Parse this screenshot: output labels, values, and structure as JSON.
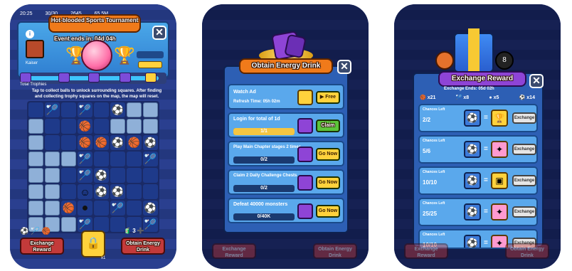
{
  "screen1": {
    "status_time": "20:25",
    "status_coins": "30/30",
    "status_gems": "2645",
    "status_energy": "65 5M",
    "title": "Hot-blooded Sports Tournament",
    "event_ends": "Event ends in: 04d 04h",
    "player_name": "Kaiser",
    "trophy_label": "Total Trophies",
    "milestones": [
      "1",
      "2",
      "3",
      "5",
      "10"
    ],
    "tip": "Tap to collect balls to unlock surrounding squares. After finding and collecting trophy squares on the map, the map will reset.",
    "collected_counts": [
      "12",
      "5",
      "4",
      "1"
    ],
    "exchange_reward_label": "Exchange Reward",
    "center_count": "x1",
    "drink_count": "3",
    "obtain_drink_label": "Obtain Energy Drink",
    "grid": [
      [
        "open",
        "shuttle",
        "open",
        "shuttle",
        "open",
        "soccer",
        "locked",
        "locked"
      ],
      [
        "locked",
        "open",
        "open",
        "basket",
        "open",
        "locked",
        "locked",
        "locked"
      ],
      [
        "locked",
        "open",
        "open",
        "basket",
        "basket",
        "soccer",
        "basket",
        "soccer"
      ],
      [
        "locked",
        "locked",
        "locked",
        "shuttle",
        "open",
        "open",
        "open",
        "shuttle"
      ],
      [
        "locked",
        "locked",
        "open",
        "shuttle",
        "soccer",
        "open",
        "open",
        "open"
      ],
      [
        "locked",
        "locked",
        "open",
        "hero",
        "soccer",
        "soccer",
        "open",
        "open"
      ],
      [
        "locked",
        "locked",
        "basket",
        "eight",
        "open",
        "shuttle",
        "open",
        "soccer"
      ],
      [
        "locked",
        "locked",
        "locked",
        "shuttle",
        "open",
        "open",
        "open",
        "shuttle"
      ]
    ]
  },
  "screen2": {
    "title": "Obtain Energy Drink",
    "tasks": [
      {
        "name": "Watch Ad",
        "sub": "Refresh Time: 05h 02m",
        "button": "Free"
      },
      {
        "name": "Login for total of 1d",
        "progress": "1/1",
        "progress_fraction": 1.0,
        "button": "Claim"
      },
      {
        "name": "Play Main Chapter stages 2 times",
        "progress": "0/2",
        "progress_fraction": 0.0,
        "button": "Go Now"
      },
      {
        "name": "Claim 2 Daily Challenge Chests",
        "progress": "0/2",
        "progress_fraction": 0.0,
        "button": "Go Now"
      },
      {
        "name": "Defeat 40000 monsters",
        "progress": "0/40K",
        "progress_fraction": 0.0,
        "button": "Go Now"
      }
    ],
    "bottom_left": "Exchange Reward",
    "bottom_right": "Obtain Energy Drink"
  },
  "screen3": {
    "title": "Exchange Reward",
    "ends": "Exchange Ends: 05d 02h",
    "currency": [
      {
        "icon": "basketball-icon",
        "count": "x21"
      },
      {
        "icon": "shuttlecock-icon",
        "count": "x8"
      },
      {
        "icon": "eight-ball-icon",
        "count": "x5"
      },
      {
        "icon": "soccer-ball-icon",
        "count": "x14"
      }
    ],
    "rows": [
      {
        "label": "Chances Left",
        "value": "2/2",
        "cost": "x40",
        "exchange": "Exchange"
      },
      {
        "label": "Chances Left",
        "value": "5/6",
        "cost": "x10",
        "exchange": "Exchange"
      },
      {
        "label": "Chances Left",
        "value": "10/10",
        "cost": "x10",
        "exchange": "Exchange"
      },
      {
        "label": "Chances Left",
        "value": "25/25",
        "cost": "x3",
        "exchange": "Exchange"
      },
      {
        "label": "Chances Left",
        "value": "10/10",
        "cost": "x3",
        "exchange": "Exchange"
      }
    ],
    "bottom_left": "Exchange Reward",
    "bottom_right": "Obtain Energy Drink"
  },
  "colors": {
    "orange": "#f07a1a",
    "purple": "#8e44d6",
    "panel_blue": "#2d5fb4",
    "task_blue": "#5aa8ec",
    "green": "#5cc43a",
    "yellow": "#ffd23c"
  }
}
